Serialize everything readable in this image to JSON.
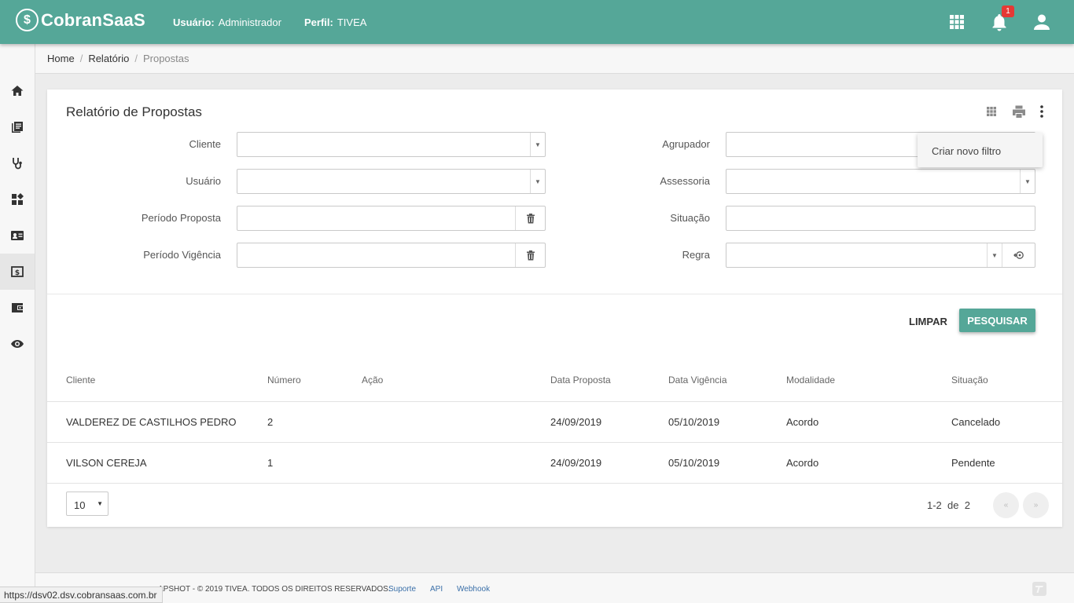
{
  "header": {
    "brand": "CobranSaaS",
    "user_label": "Usuário:",
    "user_value": "Administrador",
    "profile_label": "Perfil:",
    "profile_value": "TIVEA",
    "notification_count": "1",
    "accent_color": "#55a798"
  },
  "sidebar": {
    "items": [
      "home-icon",
      "book-icon",
      "stethoscope-icon",
      "dashboard-icon",
      "contact-card-icon",
      "money-icon",
      "wallet-icon",
      "eye-icon"
    ],
    "active_index": 5
  },
  "breadcrumb": {
    "home": "Home",
    "relatorio": "Relatório",
    "current": "Propostas"
  },
  "report": {
    "title": "Relatório de Propostas",
    "menu_item": "Criar novo filtro",
    "filters_left": [
      "Cliente",
      "Usuário",
      "Período Proposta",
      "Período Vigência"
    ],
    "filters_right": [
      "Agrupador",
      "Assessoria",
      "Situação",
      "Regra"
    ],
    "clear_label": "LIMPAR",
    "search_label": "PESQUISAR"
  },
  "table": {
    "columns": [
      "Cliente",
      "Número",
      "Ação",
      "Data Proposta",
      "Data Vigência",
      "Modalidade",
      "Situação"
    ],
    "rows": [
      {
        "cliente": "VALDEREZ DE CASTILHOS PEDRO",
        "numero": "2",
        "acao": "",
        "data_proposta": "24/09/2019",
        "data_vigencia": "05/10/2019",
        "modalidade": "Acordo",
        "situacao": "Cancelado"
      },
      {
        "cliente": "VILSON CEREJA",
        "numero": "1",
        "acao": "",
        "data_proposta": "24/09/2019",
        "data_vigencia": "05/10/2019",
        "modalidade": "Acordo",
        "situacao": "Pendente"
      }
    ]
  },
  "pagination": {
    "page_size": "10",
    "range": "1-2",
    "of_label": "de",
    "total": "2",
    "prev": "«",
    "next": "»"
  },
  "footer": {
    "copyright": "APSHOT - © 2019 TIVEA. TODOS OS DIREITOS RESERVADOS.",
    "links": [
      "Suporte",
      "API",
      "Webhook"
    ]
  },
  "status_url": "https://dsv02.dsv.cobransaas.com.br"
}
